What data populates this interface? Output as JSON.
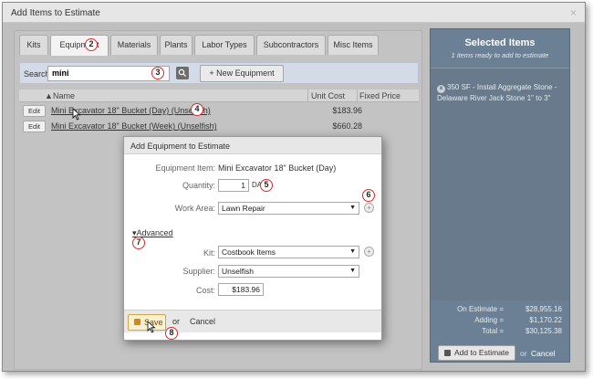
{
  "window": {
    "title": "Add Items to Estimate",
    "close_glyph": "×"
  },
  "tabs": [
    {
      "label": "Kits",
      "active": false
    },
    {
      "label": "Equipment",
      "active": true
    },
    {
      "label": "Materials",
      "active": false
    },
    {
      "label": "Plants",
      "active": false
    },
    {
      "label": "Labor Types",
      "active": false
    },
    {
      "label": "Subcontractors",
      "active": false
    },
    {
      "label": "Misc Items",
      "active": false
    }
  ],
  "search": {
    "label": "Search:",
    "value": "mini",
    "new_button": "New Equipment",
    "button_icon": "search-icon"
  },
  "grid": {
    "columns": [
      "Name",
      "Unit Cost",
      "Fixed Price"
    ],
    "rows": [
      {
        "edit": "Edit",
        "name": "Mini Excavator 18\" Bucket (Day) (Unselfish)",
        "unit_cost": "$183.96"
      },
      {
        "edit": "Edit",
        "name": "Mini Excavator 18\" Bucket (Week) (Unselfish)",
        "unit_cost": "$660.28"
      }
    ]
  },
  "selected": {
    "title": "Selected Items",
    "subtitle": "1 items ready to add to estimate",
    "item": "350 SF - Install Aggregate Stone - Delaware River Jack Stone 1\" to 3\"",
    "on_estimate_label": "On Estimate =",
    "on_estimate": "$28,955.16",
    "adding_label": "Adding =",
    "adding": "$1,170.22",
    "total_label": "Total =",
    "total": "$30,125.38",
    "add_button": "Add to Estimate",
    "or": "or",
    "cancel": "Cancel"
  },
  "dialog": {
    "title": "Add Equipment to Estimate",
    "equipment_item_label": "Equipment Item:",
    "equipment_item_value": "Mini Excavator 18\" Bucket (Day)",
    "quantity_label": "Quantity:",
    "quantity_value": "1",
    "quantity_unit": "DA",
    "work_area_label": "Work Area:",
    "work_area_value": "Lawn Repair",
    "advanced_label": "Advanced",
    "kit_label": "Kit:",
    "kit_value": "Costbook Items",
    "supplier_label": "Supplier:",
    "supplier_value": "Unselfish",
    "cost_label": "Cost:",
    "cost_value": "$183.96",
    "save_label": "Save",
    "or": "or",
    "cancel_label": "Cancel"
  },
  "callouts": [
    "1",
    "2",
    "3",
    "4",
    "5",
    "6",
    "7",
    "8"
  ],
  "colors": {
    "callout_border": "#d92b2b",
    "right_panel": "#6b8094",
    "search_bar": "#d4dbe6",
    "save_button": "#fdf0cf"
  }
}
